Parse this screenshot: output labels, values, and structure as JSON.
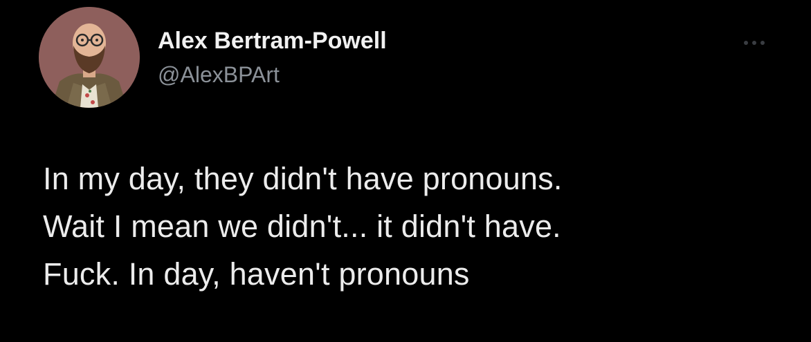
{
  "author": {
    "display_name": "Alex Bertram-Powell",
    "handle": "@AlexBPArt",
    "avatar_icon": "illustrated-bearded-man-avatar"
  },
  "menu": {
    "icon": "more-options-icon"
  },
  "tweet": {
    "text": "In my day, they didn't have pronouns.\nWait I mean we didn't... it didn't have.\nFuck. In day, haven't pronouns"
  },
  "colors": {
    "background": "#000000",
    "name": "#f1f1f1",
    "handle": "#8b9198",
    "body_text": "#ececec",
    "avatar_bg": "#8e5f5c"
  }
}
